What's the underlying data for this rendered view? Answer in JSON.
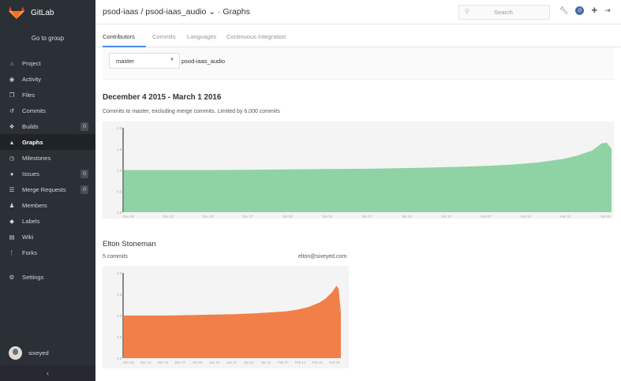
{
  "sidebar": {
    "brand": "GitLab",
    "goto": "Go to group",
    "items": [
      {
        "label": "Project",
        "icon": "home-icon",
        "glyph": "⌂"
      },
      {
        "label": "Activity",
        "icon": "dashboard-icon",
        "glyph": "◉"
      },
      {
        "label": "Files",
        "icon": "files-icon",
        "glyph": "❐"
      },
      {
        "label": "Commits",
        "icon": "history-icon",
        "glyph": "↺"
      },
      {
        "label": "Builds",
        "icon": "cubes-icon",
        "glyph": "❖",
        "count": "0"
      },
      {
        "label": "Graphs",
        "icon": "area-chart-icon",
        "glyph": "▲",
        "active": true
      },
      {
        "label": "Milestones",
        "icon": "clock-icon",
        "glyph": "◷"
      },
      {
        "label": "Issues",
        "icon": "exclamation-circle-icon",
        "glyph": "●",
        "count": "0"
      },
      {
        "label": "Merge Requests",
        "icon": "tasks-icon",
        "glyph": "☰",
        "count": "0"
      },
      {
        "label": "Members",
        "icon": "users-icon",
        "glyph": "♟"
      },
      {
        "label": "Labels",
        "icon": "tags-icon",
        "glyph": "◆"
      },
      {
        "label": "Wiki",
        "icon": "book-icon",
        "glyph": "▤"
      },
      {
        "label": "Forks",
        "icon": "code-fork-icon",
        "glyph": "ᚴ"
      }
    ],
    "settings": {
      "label": "Settings",
      "icon": "cogs-icon",
      "glyph": "⚙"
    },
    "user": "sixeyed",
    "collapse_glyph": "‹"
  },
  "header": {
    "title": "psod-iaas / psod-iaas_audio ⌄ · Graphs",
    "search_placeholder": "Search",
    "todos_count": "0"
  },
  "tabs": [
    "Contributors",
    "Commits",
    "Languages",
    "Continuous Integration"
  ],
  "branch": {
    "selected": "master",
    "repo": "psod-iaas_audio"
  },
  "range_title": "December 4 2015 - March 1 2016",
  "range_desc": "Commits to master, excluding merge commits. Limited by 6,000 commits",
  "author": {
    "name": "Elton Stoneman",
    "commits": "5 commits",
    "email": "elton@sixeyed.com"
  },
  "colors": {
    "main_fill": "#8fd3a4",
    "contrib_fill": "#f08048",
    "axis": "#999999"
  },
  "chart_data": [
    {
      "type": "area",
      "name": "all-contributors",
      "x_ticks": [
        "Dec 06",
        "Dec 13",
        "Dec 20",
        "Dec 27",
        "Jan 03",
        "Jan 10",
        "Jan 17",
        "Jan 24",
        "Jan 31",
        "Feb 07",
        "Feb 14",
        "Feb 21",
        "Feb 28"
      ],
      "y_ticks": [
        "2.0",
        "1.5",
        "1.0",
        "0.5",
        "0.0"
      ],
      "ylim": [
        0,
        2
      ],
      "x": [
        0,
        0.1,
        0.2,
        0.3,
        0.4,
        0.5,
        0.6,
        0.7,
        0.75,
        0.8,
        0.85,
        0.9,
        0.93,
        0.96,
        0.98,
        0.99,
        1.0
      ],
      "values": [
        1.0,
        1.0,
        1.0,
        1.01,
        1.02,
        1.03,
        1.05,
        1.08,
        1.1,
        1.13,
        1.18,
        1.26,
        1.34,
        1.46,
        1.63,
        1.65,
        1.5
      ]
    },
    {
      "type": "area",
      "name": "Elton Stoneman",
      "x_ticks": [
        "Dec 06",
        "Dec 13",
        "Dec 20",
        "Dec 27",
        "Jan 03",
        "Jan 10",
        "Jan 17",
        "Jan 24",
        "Jan 31",
        "Feb 07",
        "Feb 14",
        "Feb 21",
        "Feb 28"
      ],
      "y_ticks": [
        "2.0",
        "1.5",
        "1.0",
        "0.5",
        "0.0"
      ],
      "ylim": [
        0,
        2
      ],
      "x": [
        0,
        0.1,
        0.2,
        0.3,
        0.4,
        0.5,
        0.6,
        0.7,
        0.75,
        0.8,
        0.85,
        0.9,
        0.93,
        0.96,
        0.98,
        0.99,
        1.0
      ],
      "values": [
        1.0,
        1.0,
        1.0,
        1.01,
        1.02,
        1.03,
        1.05,
        1.08,
        1.1,
        1.14,
        1.2,
        1.3,
        1.4,
        1.55,
        1.7,
        1.62,
        1.05
      ]
    }
  ]
}
